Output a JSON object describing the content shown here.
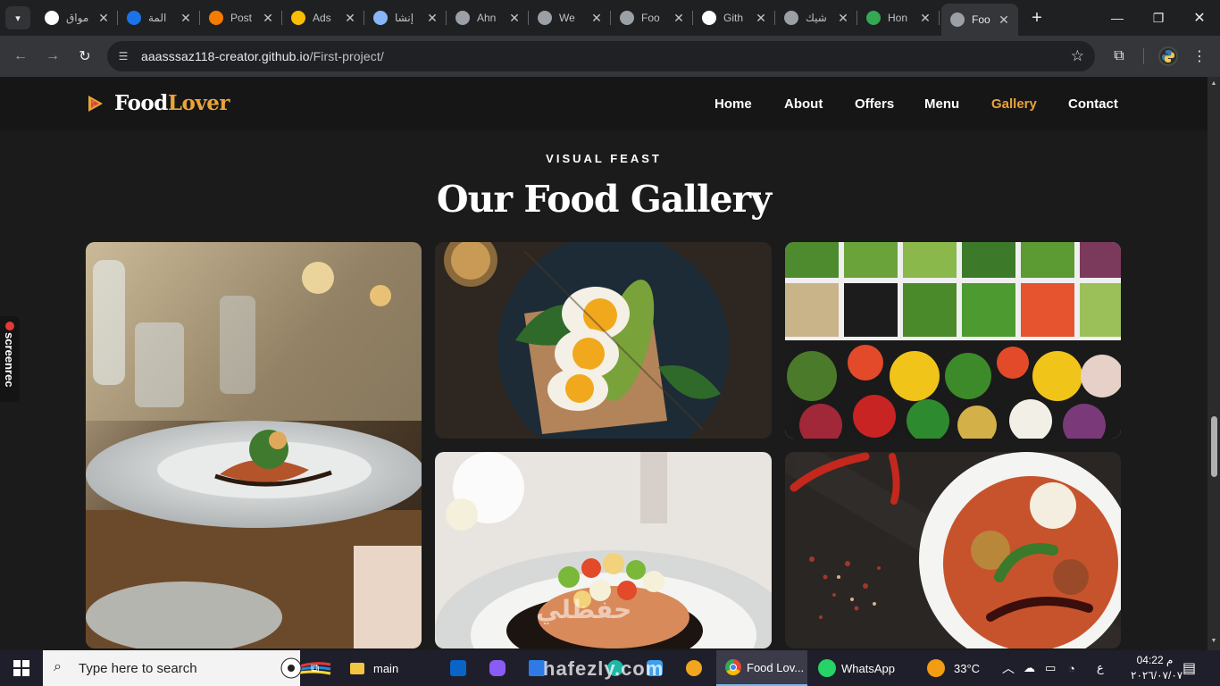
{
  "browser": {
    "tabs": [
      {
        "title": "مواق",
        "favicon": "google-icon",
        "color": "#ffffff"
      },
      {
        "title": "المة",
        "favicon": "spiral-icon",
        "color": "#1a73e8"
      },
      {
        "title": "Post",
        "favicon": "blogger-icon",
        "color": "#f57c00"
      },
      {
        "title": "Ads",
        "favicon": "google-ads-icon",
        "color": "#fbbc04"
      },
      {
        "title": "إنشا",
        "favicon": "gemini-icon",
        "color": "#8ab4f8"
      },
      {
        "title": "Ahn",
        "favicon": "globe-icon",
        "color": "#9aa0a6"
      },
      {
        "title": "We",
        "favicon": "globe-icon",
        "color": "#9aa0a6"
      },
      {
        "title": "Foo",
        "favicon": "globe-icon",
        "color": "#9aa0a6"
      },
      {
        "title": "Gith",
        "favicon": "github-icon",
        "color": "#ffffff"
      },
      {
        "title": "شيك",
        "favicon": "globe-icon",
        "color": "#9aa0a6"
      },
      {
        "title": "Hon",
        "favicon": "google-drive-icon",
        "color": "#34a853"
      },
      {
        "title": "Foo",
        "favicon": "globe-icon",
        "color": "#9aa0a6"
      }
    ],
    "active_tab_index": 11,
    "url_host": "aaasssaz118-creator.github.io",
    "url_path": "/First-project/"
  },
  "site": {
    "logo_food": "Food",
    "logo_lover": "Lover",
    "nav": [
      {
        "label": "Home",
        "active": false
      },
      {
        "label": "About",
        "active": false
      },
      {
        "label": "Offers",
        "active": false
      },
      {
        "label": "Menu",
        "active": false
      },
      {
        "label": "Gallery",
        "active": true
      },
      {
        "label": "Contact",
        "active": false
      }
    ],
    "accent": "#e8a33a",
    "section_eyebrow": "VISUAL FEAST",
    "section_title": "Our Food Gallery",
    "gallery": [
      {
        "name": "plated-fine-dining-photo"
      },
      {
        "name": "egg-avocado-toast-photo"
      },
      {
        "name": "salad-bar-bowls-photo"
      },
      {
        "name": "salmon-salsa-photo"
      },
      {
        "name": "curry-bowl-chili-photo"
      }
    ]
  },
  "overlay": {
    "screenrec_label": "screenrec",
    "watermark_text": "hafezly.com"
  },
  "taskbar": {
    "search_placeholder": "Type here to search",
    "items": [
      {
        "label": "main",
        "icon": "folder-icon"
      },
      {
        "label": "Food Lov...",
        "icon": "chrome-icon"
      },
      {
        "label": "WhatsApp",
        "icon": "whatsapp-icon"
      }
    ],
    "temperature": "33°C",
    "keyboard_lang": "ع",
    "time": "04:22 م",
    "date": "٢٠٢٦/٠٧/٠٧"
  }
}
